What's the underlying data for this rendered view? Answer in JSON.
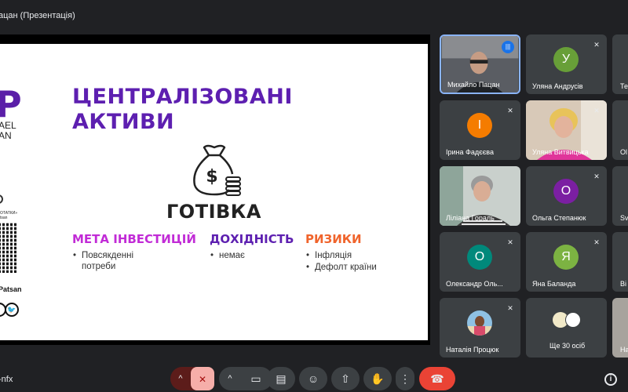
{
  "window": {
    "title": "ацан (Презентація)"
  },
  "slide": {
    "logo_letter": "P",
    "logo_line1": "AEL",
    "logo_line2": "AN",
    "logo_tag": "ОТАТКИ»",
    "logo_tag2": "tsan",
    "handle": "Patsan",
    "title_line1": "ЦЕНТРАЛІЗОВАНІ",
    "title_line2": "АКТИВИ",
    "subtitle": "ГОТІВКА",
    "columns": [
      {
        "heading": "МЕТА ІНВЕСТИЦІЙ",
        "color": "#c12bd6",
        "items": [
          "Повсякденні потреби"
        ]
      },
      {
        "heading": "ДОХІДНІСТЬ",
        "color": "#5d1fb0",
        "items": [
          "немає"
        ]
      },
      {
        "heading": "РИЗИКИ",
        "color": "#f0642c",
        "items": [
          "Інфляція",
          "Дефолт країни"
        ]
      }
    ]
  },
  "participants": [
    {
      "name": "Михайло Пацан",
      "type": "photo",
      "state": "speaking"
    },
    {
      "name": "Уляна Андрусів",
      "type": "avatar",
      "initial": "У",
      "color": "#689f38",
      "state": "muted"
    },
    {
      "name": "Те",
      "type": "cut",
      "state": "muted"
    },
    {
      "name": "Ірина Фадєєва",
      "type": "avatar",
      "initial": "І",
      "color": "#f57c00",
      "state": "muted"
    },
    {
      "name": "Уляна Витвицька",
      "type": "photo",
      "state": "muted"
    },
    {
      "name": "Ol",
      "type": "cut",
      "state": "muted"
    },
    {
      "name": "Лілiана Гораль",
      "type": "photo",
      "state": "muted"
    },
    {
      "name": "Ольга Степанюк",
      "type": "avatar",
      "initial": "О",
      "color": "#7b1fa2",
      "state": "muted"
    },
    {
      "name": "Sv",
      "type": "cut",
      "state": "muted"
    },
    {
      "name": "Олександр Оль...",
      "type": "avatar",
      "initial": "О",
      "color": "#00897b",
      "state": "muted"
    },
    {
      "name": "Яна Баланда",
      "type": "avatar",
      "initial": "Я",
      "color": "#7cb342",
      "state": "muted"
    },
    {
      "name": "Ві",
      "type": "cut",
      "state": "muted"
    },
    {
      "name": "Наталія Процюк",
      "type": "photo",
      "state": "muted"
    },
    {
      "name": "Ще 30 осіб",
      "type": "more",
      "state": ""
    },
    {
      "name": "На",
      "type": "cut",
      "state": ""
    }
  ],
  "bottom": {
    "meeting_code": "-nfx"
  },
  "icons": {
    "caret_up": "^",
    "mic_off": "🎤",
    "camera": "▭",
    "captions": "▤",
    "emoji": "☺",
    "present": "⇧",
    "hand": "✋",
    "more": "⋮",
    "hangup": "☎",
    "info": "i",
    "muted": "✕",
    "speaking": "|||"
  }
}
